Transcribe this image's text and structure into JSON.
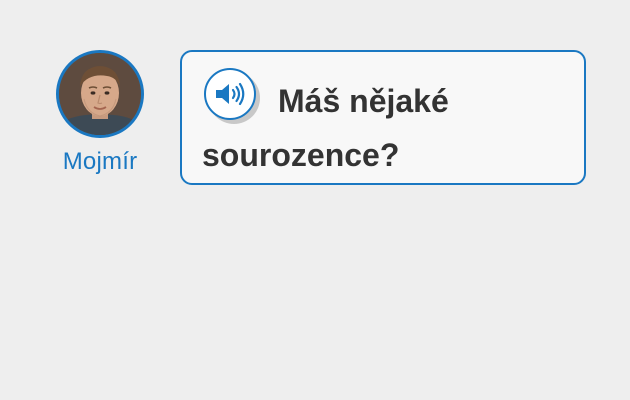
{
  "speaker": {
    "name": "Mojmír",
    "avatar_icon": "man-portrait"
  },
  "bubble": {
    "audio_icon": "speaker-volume-icon",
    "text": "Máš nějaké sourozence?"
  },
  "colors": {
    "accent": "#1a78c2",
    "background": "#eeeeee",
    "bubble_bg": "#f8f8f8",
    "text": "#333333"
  }
}
